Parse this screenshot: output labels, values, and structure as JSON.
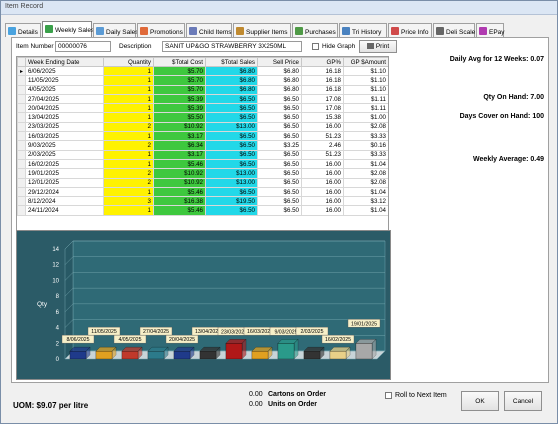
{
  "window": {
    "title": "Item Record"
  },
  "tabs": [
    {
      "label": "Details",
      "color": "#4aa3df"
    },
    {
      "label": "Weekly Sales",
      "color": "#3aa04a",
      "active": true
    },
    {
      "label": "Daily Sales",
      "color": "#5b9bd5"
    },
    {
      "label": "Promotions",
      "color": "#e06a3a"
    },
    {
      "label": "Child Items",
      "color": "#6a7ab8"
    },
    {
      "label": "Supplier Items",
      "color": "#c08a30"
    },
    {
      "label": "Purchases",
      "color": "#4f9a46"
    },
    {
      "label": "Tri History",
      "color": "#4a82c0"
    },
    {
      "label": "Price Info",
      "color": "#d04a4a"
    },
    {
      "label": "Deli Scale",
      "color": "#666666"
    },
    {
      "label": "EPay",
      "color": "#b03ab0"
    }
  ],
  "item": {
    "number_label": "Item Number",
    "number": "00000076",
    "desc_label": "Description",
    "desc": "SANIT UP&GO STRAWBERRY 3X250ML",
    "hide_graph": "Hide Graph",
    "print": "Print"
  },
  "table": {
    "headers": [
      "Week Ending Date",
      "Quantity",
      "$Total Cost",
      "$Total Sales",
      "Sell Price",
      "GP%",
      "GP $Amount"
    ],
    "rows": [
      [
        "6/06/2025",
        "1",
        "$5.70",
        "$6.80",
        "$6.80",
        "16.18",
        "$1.10"
      ],
      [
        "11/05/2025",
        "1",
        "$5.70",
        "$6.80",
        "$6.80",
        "16.18",
        "$1.10"
      ],
      [
        "4/05/2025",
        "1",
        "$5.70",
        "$6.80",
        "$6.80",
        "16.18",
        "$1.10"
      ],
      [
        "27/04/2025",
        "1",
        "$5.39",
        "$6.50",
        "$6.50",
        "17.08",
        "$1.11"
      ],
      [
        "20/04/2025",
        "1",
        "$5.39",
        "$6.50",
        "$6.50",
        "17.08",
        "$1.11"
      ],
      [
        "13/04/2025",
        "1",
        "$5.50",
        "$6.50",
        "$6.50",
        "15.38",
        "$1.00"
      ],
      [
        "23/03/2025",
        "2",
        "$10.92",
        "$13.00",
        "$6.50",
        "16.00",
        "$2.08"
      ],
      [
        "16/03/2025",
        "1",
        "$3.17",
        "$6.50",
        "$6.50",
        "51.23",
        "$3.33"
      ],
      [
        "9/03/2025",
        "2",
        "$6.34",
        "$6.50",
        "$3.25",
        "2.46",
        "$0.16"
      ],
      [
        "2/03/2025",
        "1",
        "$3.17",
        "$6.50",
        "$6.50",
        "51.23",
        "$3.33"
      ],
      [
        "16/02/2025",
        "1",
        "$5.46",
        "$6.50",
        "$6.50",
        "16.00",
        "$1.04"
      ],
      [
        "19/01/2025",
        "2",
        "$10.92",
        "$13.00",
        "$6.50",
        "16.00",
        "$2.08"
      ],
      [
        "12/01/2025",
        "2",
        "$10.92",
        "$13.00",
        "$6.50",
        "16.00",
        "$2.08"
      ],
      [
        "29/12/2024",
        "1",
        "$5.46",
        "$6.50",
        "$6.50",
        "16.00",
        "$1.04"
      ],
      [
        "8/12/2024",
        "3",
        "$16.38",
        "$19.50",
        "$6.50",
        "16.00",
        "$3.12"
      ],
      [
        "24/11/2024",
        "1",
        "$5.46",
        "$6.50",
        "$6.50",
        "16.00",
        "$1.04"
      ]
    ]
  },
  "stats": {
    "daily_avg": "Daily Avg for 12 Weeks: 0.07",
    "qty_on_hand": "Qty On Hand: 7.00",
    "days_cover": "Days Cover on Hand: 100",
    "weekly_avg": "Weekly Average: 0.49"
  },
  "chart_data": {
    "type": "bar",
    "ylabel": "Qty",
    "ylim": [
      0,
      14
    ],
    "yticks": [
      "0",
      "2",
      "4",
      "6",
      "8",
      "10",
      "12",
      "14"
    ],
    "categories": [
      "8/06/2025",
      "11/05/2025",
      "4/05/2025",
      "27/04/2025",
      "20/04/2025",
      "13/04/2025",
      "23/03/2025",
      "16/03/2025",
      "9/03/2025",
      "2/03/2025",
      "16/02/2025",
      "19/01/2025"
    ],
    "values": [
      1,
      1,
      1,
      1,
      1,
      1,
      2,
      1,
      2,
      1,
      1,
      2
    ],
    "colors": [
      "#1f3a8a",
      "#e0a020",
      "#c0392b",
      "#2c7a8a",
      "#1f3a8a",
      "#333333",
      "#b01818",
      "#e0a020",
      "#2a9a8a",
      "#333333",
      "#e8d088",
      "#a8a8a8"
    ]
  },
  "bottom": {
    "uom": "UOM:  $9.07  per litre",
    "cartons_val": "0.00",
    "cartons_label": "Cartons on Order",
    "units_val": "0.00",
    "units_label": "Units on Order",
    "roll": "Roll to Next Item",
    "ok": "OK",
    "cancel": "Cancel"
  }
}
